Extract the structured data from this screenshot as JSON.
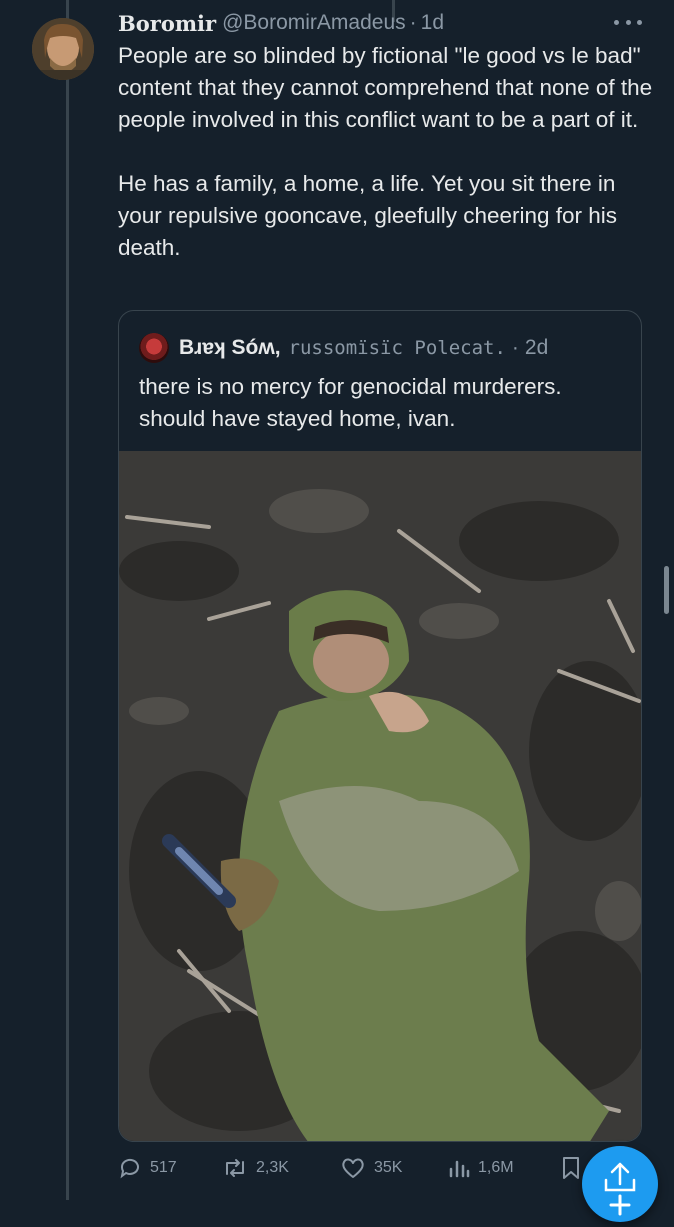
{
  "tweet": {
    "author_name": "Boromir",
    "handle": "@BoromirAmadeus",
    "separator": "·",
    "time": "1d",
    "text": "People are so blinded by fictional \"le good vs le bad\" content that they cannot comprehend that none of the people involved in this conflict want to be a part of it.\n\nHe has a family, a home, a life. Yet you sit there in your repulsive gooncave, gleefully cheering for his death.",
    "more_icon": "more-horizontal-icon"
  },
  "quote": {
    "author_name": "Bɹɐʞ Sóʍ,",
    "handle": "russomïsïc Polecat.",
    "separator": "·",
    "time": "2d",
    "text": "there is no mercy for genocidal murderers.\nshould have stayed home, ivan."
  },
  "actions": {
    "replies": "517",
    "retweets": "2,3K",
    "likes": "35K",
    "views": "1,6M",
    "icons": [
      "reply-icon",
      "retweet-icon",
      "heart-icon",
      "views-chart-icon",
      "bookmark-icon",
      "share-icon"
    ]
  },
  "colors": {
    "background": "#15202b",
    "text": "#e7e9ea",
    "secondary_text": "#8b98a5",
    "border": "#38444d",
    "accent": "#1d9bf0"
  }
}
